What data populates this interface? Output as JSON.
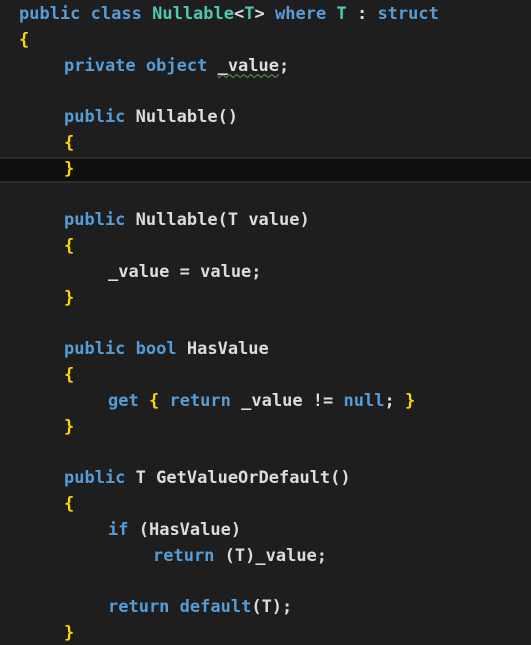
{
  "colors": {
    "background": "#1e1e1e",
    "keyword": "#569cd6",
    "type": "#4ec9b0",
    "plain": "#dcdcdc",
    "brace": "#ffd700",
    "current_line": "#0f0f0f",
    "squiggle": "#6a9955"
  },
  "code": {
    "l1": {
      "public": "public",
      "class": "class",
      "name": "Nullable",
      "lt": "<",
      "T": "T",
      "gt": ">",
      "where": "where",
      "T2": "T",
      "colon": ":",
      "struct": "struct"
    },
    "l2": {
      "open": "{"
    },
    "l3": {
      "private": "private",
      "object": "object",
      "field": "_value",
      "semi": ";"
    },
    "l5": {
      "public": "public",
      "name": "Nullable",
      "parens": "()"
    },
    "l6": {
      "open": "{"
    },
    "l7": {
      "close": "}"
    },
    "l9": {
      "public": "public",
      "name": "Nullable",
      "lparen": "(",
      "T": "T",
      "param": "value",
      "rparen": ")"
    },
    "l10": {
      "open": "{"
    },
    "l11": {
      "stmt": "_value = value;"
    },
    "l12": {
      "close": "}"
    },
    "l14": {
      "public": "public",
      "bool": "bool",
      "name": "HasValue"
    },
    "l15": {
      "open": "{"
    },
    "l16": {
      "get": "get",
      "lb": "{",
      "return": "return",
      "expr": "_value !=",
      "null": "null",
      "semi": ";",
      "rb": "}"
    },
    "l17": {
      "close": "}"
    },
    "l19": {
      "public": "public",
      "T": "T",
      "name": "GetValueOrDefault",
      "parens": "()"
    },
    "l20": {
      "open": "{"
    },
    "l21": {
      "if": "if",
      "cond": "(HasValue)"
    },
    "l22": {
      "return": "return",
      "expr": "(T)_value;"
    },
    "l24": {
      "return": "return",
      "default": "default",
      "args": "(T);"
    },
    "l25": {
      "close": "}"
    }
  }
}
